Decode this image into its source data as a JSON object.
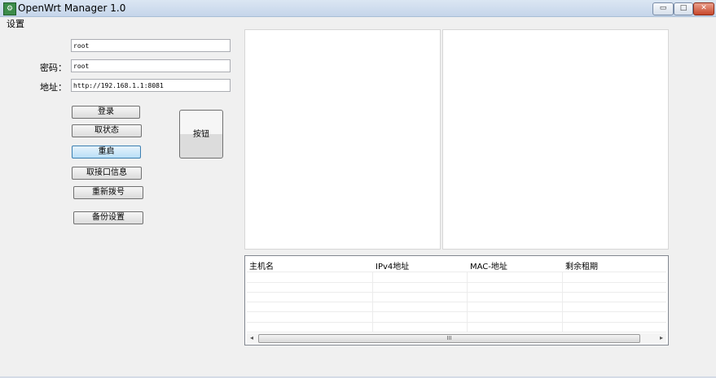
{
  "window": {
    "title": "OpenWrt Manager 1.0",
    "icon": "openwrt-app-icon",
    "controls": {
      "minimize": "▭",
      "maximize": "□",
      "close": "✕"
    }
  },
  "menu": {
    "settings": "设置"
  },
  "form": {
    "username": {
      "label": "",
      "value": "root"
    },
    "password": {
      "label": "密码：",
      "value": "root"
    },
    "address": {
      "label": "地址：",
      "value": "http://192.168.1.1:8081"
    }
  },
  "buttons": {
    "login": "登录",
    "get_status": "取状态",
    "restart": "重启",
    "get_interface_info": "取接口信息",
    "redial": "重新拨号",
    "backup_settings": "备份设置",
    "big_button": "按钮"
  },
  "table": {
    "headers": [
      "主机名",
      "IPv4地址",
      "MAC-地址",
      "剩余租期"
    ],
    "rows": []
  },
  "scrollbar": {
    "left": "◂",
    "right": "▸",
    "grip": "III"
  }
}
